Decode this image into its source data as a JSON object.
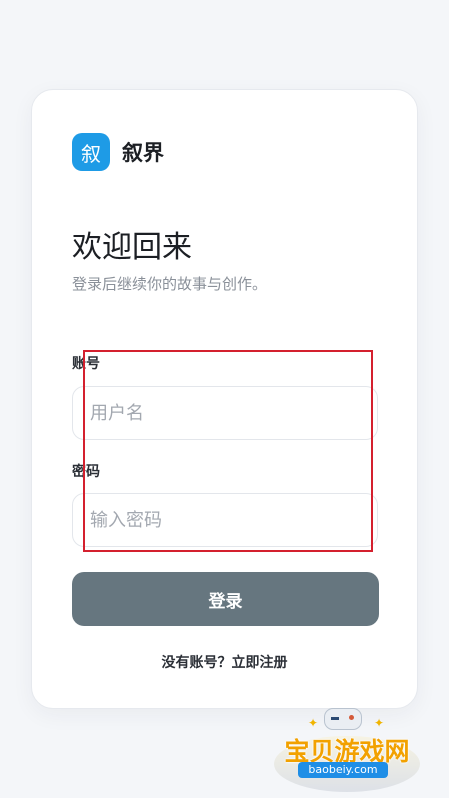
{
  "brand": {
    "logo_char": "叙",
    "name": "叙界",
    "accent": "#1e9be6"
  },
  "header": {
    "title": "欢迎回来",
    "subtitle": "登录后继续你的故事与创作。"
  },
  "form": {
    "username": {
      "label": "账号",
      "placeholder": "用户名",
      "value": ""
    },
    "password": {
      "label": "密码",
      "placeholder": "输入密码",
      "value": ""
    },
    "submit_label": "登录",
    "submit_color": "#66767f"
  },
  "footer": {
    "prompt": "没有账号？",
    "register_link": "立即注册"
  },
  "watermark": {
    "text": "宝贝游戏网",
    "url": "baobeiy.com"
  }
}
